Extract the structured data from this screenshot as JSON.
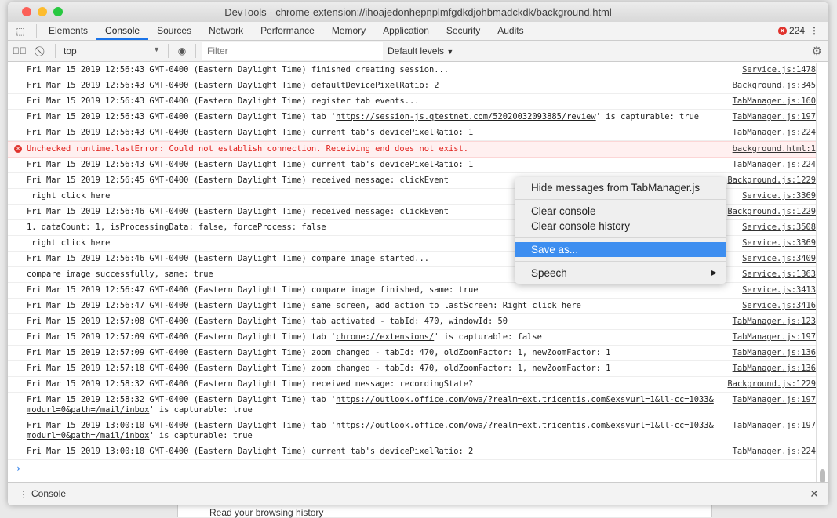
{
  "background_page": {
    "text": "Read your browsing history"
  },
  "window": {
    "title": "DevTools - chrome-extension://ihoajedonhepnplmfgdkdjohbmadckdk/background.html"
  },
  "tabs": [
    "Elements",
    "Console",
    "Sources",
    "Network",
    "Performance",
    "Memory",
    "Application",
    "Security",
    "Audits"
  ],
  "active_tab": "Console",
  "error_count": "224",
  "toolbar": {
    "context": "top",
    "filter_placeholder": "Filter",
    "levels": "Default levels"
  },
  "log": [
    {
      "msg": "Fri Mar 15 2019 12:56:43 GMT-0400 (Eastern Daylight Time) finished creating session...",
      "src": "Service.js:1478"
    },
    {
      "msg": "Fri Mar 15 2019 12:56:43 GMT-0400 (Eastern Daylight Time) defaultDevicePixelRatio: 2",
      "src": "Background.js:345"
    },
    {
      "msg": "Fri Mar 15 2019 12:56:43 GMT-0400 (Eastern Daylight Time) register tab events...",
      "src": "TabManager.js:160"
    },
    {
      "pre": "Fri Mar 15 2019 12:56:43 GMT-0400 (Eastern Daylight Time) tab '",
      "link": "https://session-js.qtestnet.com/52020032093885/review",
      "post": "' is capturable: true",
      "src": "TabManager.js:197"
    },
    {
      "msg": "Fri Mar 15 2019 12:56:43 GMT-0400 (Eastern Daylight Time) current tab's devicePixelRatio: 1",
      "src": "TabManager.js:224"
    },
    {
      "msg": "Unchecked runtime.lastError: Could not establish connection. Receiving end does not exist.",
      "src": "background.html:1",
      "error": true
    },
    {
      "msg": "Fri Mar 15 2019 12:56:43 GMT-0400 (Eastern Daylight Time) current tab's devicePixelRatio: 1",
      "src": "TabManager.js:224"
    },
    {
      "msg": "Fri Mar 15 2019 12:56:45 GMT-0400 (Eastern Daylight Time) received message: clickEvent",
      "src": "Background.js:1229"
    },
    {
      "msg": " right click here",
      "src": "Service.js:3369"
    },
    {
      "msg": "Fri Mar 15 2019 12:56:46 GMT-0400 (Eastern Daylight Time) received message: clickEvent",
      "src": "Background.js:1229"
    },
    {
      "msg": "1. dataCount: 1, isProcessingData: false, forceProcess: false",
      "src": "Service.js:3508"
    },
    {
      "msg": " right click here",
      "src": "Service.js:3369"
    },
    {
      "msg": "Fri Mar 15 2019 12:56:46 GMT-0400 (Eastern Daylight Time) compare image started...",
      "src": "Service.js:3409"
    },
    {
      "msg": "compare image successfully, same: true",
      "src": "Service.js:1363"
    },
    {
      "msg": "Fri Mar 15 2019 12:56:47 GMT-0400 (Eastern Daylight Time) compare image finished, same: true",
      "src": "Service.js:3413"
    },
    {
      "msg": "Fri Mar 15 2019 12:56:47 GMT-0400 (Eastern Daylight Time) same screen, add action to lastScreen: Right click here",
      "src": "Service.js:3416"
    },
    {
      "msg": "Fri Mar 15 2019 12:57:08 GMT-0400 (Eastern Daylight Time) tab activated - tabId: 470, windowId: 50",
      "src": "TabManager.js:123"
    },
    {
      "pre": "Fri Mar 15 2019 12:57:09 GMT-0400 (Eastern Daylight Time) tab '",
      "link": "chrome://extensions/",
      "post": "' is capturable: false",
      "src": "TabManager.js:197"
    },
    {
      "msg": "Fri Mar 15 2019 12:57:09 GMT-0400 (Eastern Daylight Time) zoom changed - tabId: 470, oldZoomFactor: 1, newZoomFactor: 1",
      "src": "TabManager.js:136"
    },
    {
      "msg": "Fri Mar 15 2019 12:57:18 GMT-0400 (Eastern Daylight Time) zoom changed - tabId: 470, oldZoomFactor: 1, newZoomFactor: 1",
      "src": "TabManager.js:136"
    },
    {
      "msg": "Fri Mar 15 2019 12:58:32 GMT-0400 (Eastern Daylight Time) received message: recordingState?",
      "src": "Background.js:1229"
    },
    {
      "pre": "Fri Mar 15 2019 12:58:32 GMT-0400 (Eastern Daylight Time) tab '",
      "link": "https://outlook.office.com/owa/?realm=ext.tricentis.com&exsvurl=1&ll-cc=1033&modurl=0&path=/mail/inbox",
      "post": "' is capturable: true",
      "src": "TabManager.js:197"
    },
    {
      "pre": "Fri Mar 15 2019 13:00:10 GMT-0400 (Eastern Daylight Time) tab '",
      "link": "https://outlook.office.com/owa/?realm=ext.tricentis.com&exsvurl=1&ll-cc=1033&modurl=0&path=/mail/inbox",
      "post": "' is capturable: true",
      "src": "TabManager.js:197"
    },
    {
      "msg": "Fri Mar 15 2019 13:00:10 GMT-0400 (Eastern Daylight Time) current tab's devicePixelRatio: 2",
      "src": "TabManager.js:224"
    }
  ],
  "prompt": "›",
  "drawer": {
    "tab": "Console"
  },
  "context_menu": {
    "items": [
      "Hide messages from TabManager.js",
      "Clear console",
      "Clear console history",
      "Save as...",
      "Speech"
    ],
    "highlighted": "Save as..."
  },
  "colors": {
    "accent": "#1a73e8",
    "error": "#e0201b",
    "menu_highlight": "#3d8ef0"
  }
}
